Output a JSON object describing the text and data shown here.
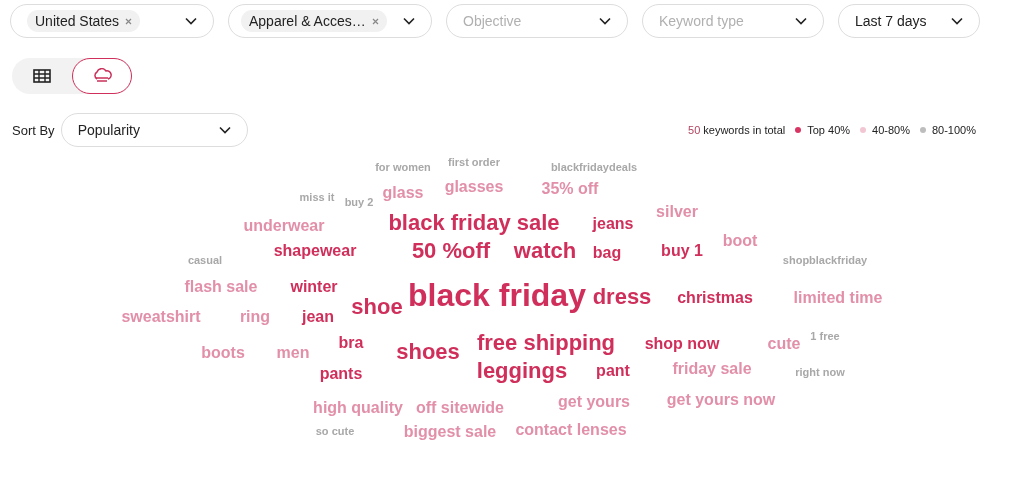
{
  "filters": [
    {
      "kind": "chip",
      "chip": "United States",
      "removable": true
    },
    {
      "kind": "chip",
      "chip": "Apparel & Acces…",
      "removable": true
    },
    {
      "kind": "placeholder",
      "placeholder": "Objective"
    },
    {
      "kind": "placeholder",
      "placeholder": "Keyword type"
    },
    {
      "kind": "value",
      "value": "Last 7 days"
    }
  ],
  "view_toggle": [
    {
      "kind": "table",
      "selected": false
    },
    {
      "kind": "cloud",
      "selected": true
    }
  ],
  "sort": {
    "label": "Sort By",
    "value": "Popularity"
  },
  "summary": {
    "count": "50",
    "label": "keywords in total"
  },
  "legend": [
    {
      "label": "Top 40%",
      "color": "#d93563"
    },
    {
      "label": "40-80%",
      "color": "#f3c6d4"
    },
    {
      "label": "80-100%",
      "color": "#bdbdbd"
    }
  ],
  "keywords": [
    {
      "text": "for women",
      "color": "#a8a8a8"
    },
    {
      "text": "first order",
      "color": "#a8a8a8"
    },
    {
      "text": "blackfridaydeals",
      "color": "#a8a8a8"
    },
    {
      "text": "miss it",
      "color": "#a8a8a8"
    },
    {
      "text": "buy 2",
      "color": "#a8a8a8"
    },
    {
      "text": "glass",
      "color": "#e28fa9"
    },
    {
      "text": "glasses",
      "color": "#e28fa9"
    },
    {
      "text": "35% off",
      "color": "#e28fa9"
    },
    {
      "text": "underwear",
      "color": "#e28fa9"
    },
    {
      "text": "black friday sale",
      "color": "#cf2f5a"
    },
    {
      "text": "jeans",
      "color": "#cf2f5a"
    },
    {
      "text": "silver",
      "color": "#e28fa9"
    },
    {
      "text": "casual",
      "color": "#a8a8a8"
    },
    {
      "text": "shapewear",
      "color": "#cf2f5a"
    },
    {
      "text": "50 %off",
      "color": "#cf2f5a"
    },
    {
      "text": "watch",
      "color": "#cf2f5a"
    },
    {
      "text": "bag",
      "color": "#cf2f5a"
    },
    {
      "text": "buy 1",
      "color": "#cf2f5a"
    },
    {
      "text": "boot",
      "color": "#e28fa9"
    },
    {
      "text": "shopblackfriday",
      "color": "#a8a8a8"
    },
    {
      "text": "flash sale",
      "color": "#e28fa9"
    },
    {
      "text": "winter",
      "color": "#cf2f5a"
    },
    {
      "text": "shoe",
      "color": "#cf2f5a"
    },
    {
      "text": "black friday",
      "color": "#cf2f5a"
    },
    {
      "text": "dress",
      "color": "#cf2f5a"
    },
    {
      "text": "christmas",
      "color": "#cf2f5a"
    },
    {
      "text": "limited time",
      "color": "#e28fa9"
    },
    {
      "text": "sweatshirt",
      "color": "#e28fa9"
    },
    {
      "text": "ring",
      "color": "#e28fa9"
    },
    {
      "text": "jean",
      "color": "#cf2f5a"
    },
    {
      "text": "boots",
      "color": "#e28fa9"
    },
    {
      "text": "men",
      "color": "#e28fa9"
    },
    {
      "text": "bra",
      "color": "#cf2f5a"
    },
    {
      "text": "shoes",
      "color": "#cf2f5a"
    },
    {
      "text": "free shipping",
      "color": "#cf2f5a"
    },
    {
      "text": "shop now",
      "color": "#cf2f5a"
    },
    {
      "text": "cute",
      "color": "#e28fa9"
    },
    {
      "text": "1 free",
      "color": "#a8a8a8"
    },
    {
      "text": "pants",
      "color": "#cf2f5a"
    },
    {
      "text": "leggings",
      "color": "#cf2f5a"
    },
    {
      "text": "pant",
      "color": "#cf2f5a"
    },
    {
      "text": "friday sale",
      "color": "#e28fa9"
    },
    {
      "text": "right now",
      "color": "#a8a8a8"
    },
    {
      "text": "high quality",
      "color": "#e28fa9"
    },
    {
      "text": "off sitewide",
      "color": "#e28fa9"
    },
    {
      "text": "get yours",
      "color": "#e28fa9"
    },
    {
      "text": "get yours now",
      "color": "#e28fa9"
    },
    {
      "text": "so cute",
      "color": "#a8a8a8"
    },
    {
      "text": "biggest sale",
      "color": "#e28fa9"
    },
    {
      "text": "contact lenses",
      "color": "#e28fa9"
    }
  ]
}
